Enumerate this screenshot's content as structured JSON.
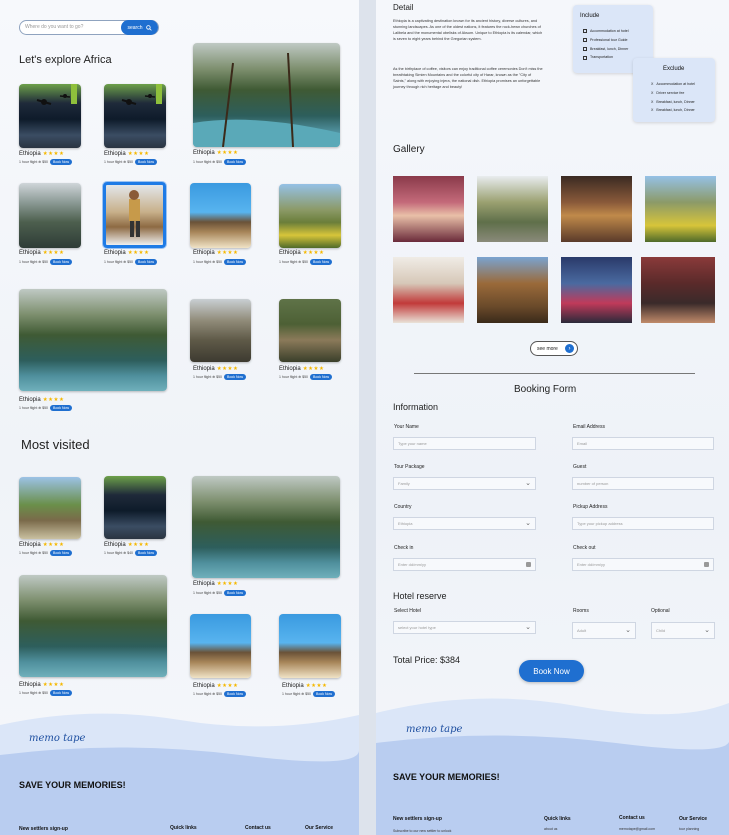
{
  "left": {
    "search": {
      "placeholder": "Where do you want to go?",
      "button": "search"
    },
    "explore_title": "Let's explore Africa",
    "most_visited_title": "Most visited",
    "card": {
      "name": "Ethiopia",
      "stars": "★★★★",
      "book": "Book Now"
    },
    "subs": {
      "a": "1 hour flight ⊕ $50",
      "b": "1 hour flight ⊕ $50",
      "c": "1 hour flight ⊕ $50",
      "d": "1 hour flight ⊕ $50",
      "e": "1 hour flight ⊕ $50",
      "f": "1 hour flight ⊕ $50",
      "g": "1 hour flight ⊕ $50",
      "h": "1 hour flight ⊕ $50",
      "i": "1 hour flight ⊕ $50",
      "j": "1 hour flight ⊕ $50",
      "k": "1 hour flight ⊕ $50",
      "l": "1 hour flight ⊕ $40",
      "m": "1 hour flight ⊕ $50",
      "n": "1 hour flight ⊕ $50",
      "o": "1 hour flight ⊕ $50",
      "p": "1 hour flight ⊕ $50",
      "q": "1 hour flight ⊕ $50"
    },
    "footer": {
      "logo": "memo tape",
      "save": "SAVE YOUR MEMORIES!",
      "signup": "New settlers sign-up",
      "quick": "Quick links",
      "contact": "Contact us",
      "service": "Our Service"
    }
  },
  "right": {
    "detail_title": "Detail",
    "detail_p1": "Ethiopia is a captivating destination known for its ancient history, diverse cultures, and stunning landscapes. As one of the oldest nations, it features the rock-hewn churches of Lalibela and the monumental obelisks of Aksum. Unique to Ethiopia is its calendar, which is seven to eight years behind the Gregorian system.",
    "detail_p2": "As the birthplace of coffee, visitors can enjoy traditional coffee ceremonies Don't miss the breathtaking Simien Mountains and the colorful city of Harar, known as the \"City of Saints,\" along with enjoying injera, the national dish. Ethiopia promises an unforgettable journey through rich heritage and beauty!",
    "include": {
      "title": "Include",
      "items": [
        "Accommodation at hotel",
        "Professional tour Guide",
        "Breakfast, lunch, Dinner",
        "Transportation"
      ]
    },
    "exclude": {
      "title": "Exclude",
      "items": [
        "Accommodation at hotel",
        "Driver service fee",
        "Breakfast, lunch, Dinner",
        "Breakfast, lunch, Dinner"
      ]
    },
    "gallery_title": "Gallery",
    "see_more": "see more",
    "booking_title": "Booking Form",
    "info_title": "Information",
    "fields": {
      "your_name": "Your Name",
      "your_name_ph": "Type your name",
      "email": "Email Address",
      "email_ph": "Email",
      "tour_package": "Tour Package",
      "tour_package_val": "Family",
      "guest": "Guest",
      "guest_ph": "number of person",
      "country": "Country",
      "country_val": "Ethiopia",
      "pickup": "Pickup Address",
      "pickup_ph": "Type your pickup address",
      "check_in": "Check in",
      "check_in_ph": "Enter dd/mm/yy",
      "check_out": "Check out",
      "check_out_ph": "Enter dd/mm/yy"
    },
    "hotel_title": "Hotel reserve",
    "hotel": {
      "select_hotel": "Select Hotel",
      "select_hotel_ph": "select your hotel type",
      "rooms": "Rooms",
      "rooms_val": "Adult",
      "optional": "Optional",
      "optional_val": "Child"
    },
    "total_price": "Total Price: $384",
    "book_now": "Book Now",
    "footer": {
      "logo": "memo tape",
      "save": "SAVE YOUR MEMORIES!",
      "signup": "New settlers sign-up",
      "signup_small": "Subscribe to our new settler to unlock",
      "quick": "Quick links",
      "quick_small": "about us",
      "contact": "Contact us",
      "contact_small": "memotape@gmail.com",
      "service": "Our Service",
      "service_small": "tour planning"
    }
  },
  "colors": {
    "accent": "#1f6fd0",
    "star": "#f5b800",
    "footer_blue": "#b9cdf0"
  }
}
